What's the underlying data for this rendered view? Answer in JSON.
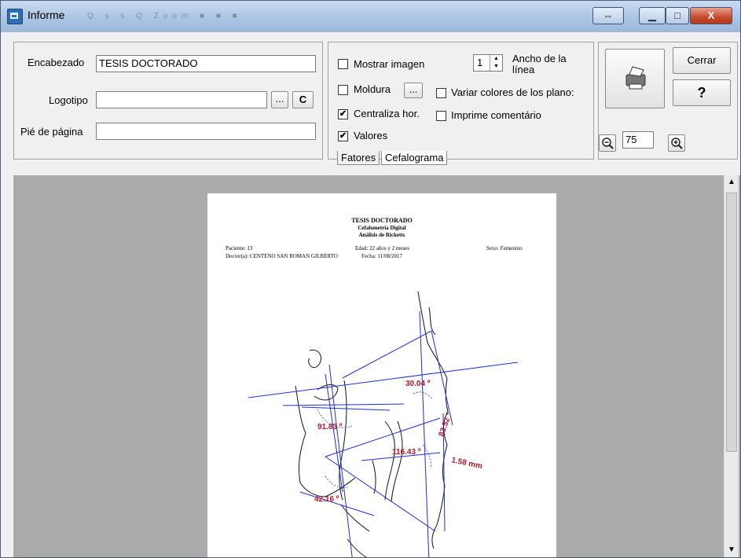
{
  "window": {
    "title": "Informe",
    "ghost_toolbar": "Q  s.s  Q  Zoom   ■ ■ ■",
    "restore_glyph": "⇔",
    "minimize_glyph": "▁",
    "maximize_glyph": "□",
    "close_glyph": "X"
  },
  "form": {
    "header_label": "Encabezado",
    "header_value": "TESIS DOCTORADO",
    "logo_label": "Logotipo",
    "logo_value": "",
    "logo_browse": "...",
    "logo_clear": "C",
    "footer_label": "Pié de página",
    "footer_value": ""
  },
  "options": {
    "show_image": {
      "label": "Mostrar imagen",
      "checked": false
    },
    "frame": {
      "label": "Moldura",
      "checked": false,
      "button": "..."
    },
    "vary_colors": {
      "label": "Variar colores de los plano:",
      "checked": false
    },
    "center_hor": {
      "label": "Centraliza hor.",
      "checked": true
    },
    "print_comment": {
      "label": "Imprime comentário",
      "checked": false
    },
    "values": {
      "label": "Valores",
      "checked": true
    },
    "line_width_label": "Ancho de la línea",
    "line_width_value": "1"
  },
  "tabs": [
    {
      "label": "Fatores",
      "active": false
    },
    {
      "label": "Cefalograma",
      "active": true
    }
  ],
  "actions": {
    "close_label": "Cerrar",
    "help_label": "?",
    "zoom_value": "75",
    "print_icon": "printer-icon",
    "zoom_out_icon": "zoom-out-icon",
    "zoom_in_icon": "zoom-in-icon"
  },
  "report": {
    "title": "TESIS DOCTORADO",
    "subtitle1": "Cefalometria Digital",
    "subtitle2": "Análisis de Ricketts",
    "patient": "Paciente:  13",
    "age": "Edad: 22 años y 2  meses",
    "sex": "Sexo: Femenino",
    "doctor": "Doctor(a):  CENTENO SAN ROMAN GILBERTO",
    "date": "Fecha: 11/08/2017",
    "measurements": [
      "30.04 º",
      "91.83 º",
      "83.52 º",
      "116.43 º",
      "1.58 mm",
      "42.16 º"
    ]
  },
  "colors": {
    "lines": "#1f2fd6",
    "values": "#b3162b",
    "tracing": "#111111"
  }
}
